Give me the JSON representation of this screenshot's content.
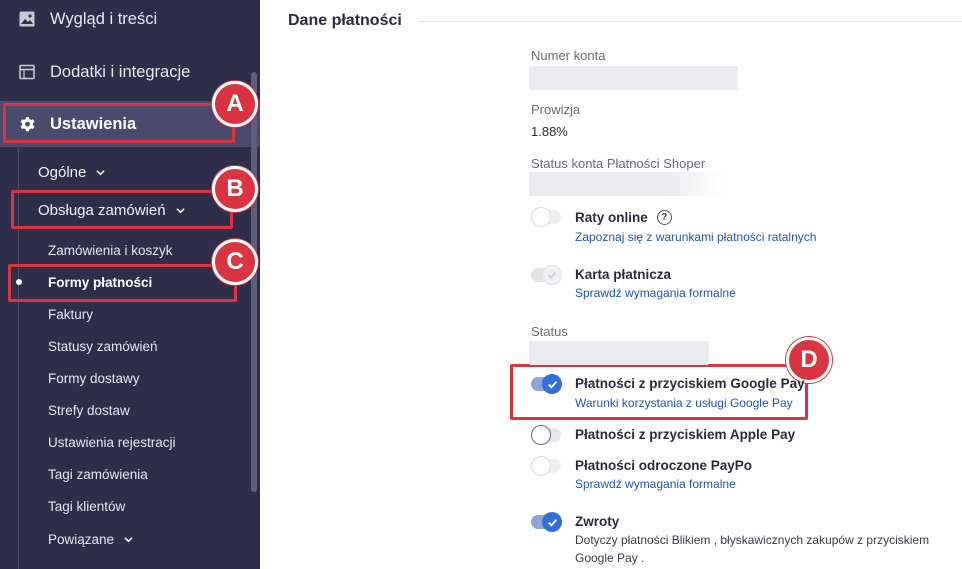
{
  "sidebar": {
    "main_items": [
      {
        "label": "Wygląd i treści",
        "icon": "image-icon"
      },
      {
        "label": "Dodatki i integracje",
        "icon": "calendar-icon"
      },
      {
        "label": "Ustawienia",
        "icon": "gear-icon"
      }
    ],
    "sub_items": [
      {
        "label": "Ogólne"
      },
      {
        "label": "Obsługa zamówień"
      }
    ],
    "order_items": [
      {
        "label": "Zamówienia i koszyk"
      },
      {
        "label": "Formy płatności"
      },
      {
        "label": "Faktury"
      },
      {
        "label": "Statusy zamówień"
      },
      {
        "label": "Formy dostawy"
      },
      {
        "label": "Strefy dostaw"
      },
      {
        "label": "Ustawienia rejestracji"
      },
      {
        "label": "Tagi zamówienia"
      },
      {
        "label": "Tagi klientów"
      },
      {
        "label": "Powiązane"
      }
    ]
  },
  "annotations": {
    "a": "A",
    "b": "B",
    "c": "C",
    "d": "D",
    "color": "#d9343f"
  },
  "main": {
    "section_title": "Dane płatności",
    "account_number_label": "Numer konta",
    "commission_label": "Prowizja",
    "commission_value": "1.88%",
    "account_status_label": "Status konta Płatności Shoper",
    "status_label": "Status",
    "options": [
      {
        "title": "Raty online",
        "link": "Zapoznaj się z warunkami płatności ratalnych",
        "state": "off-disabled"
      },
      {
        "title": "Karta płatnicza",
        "link": "Sprawdź wymagania formalne",
        "state": "on-disabled"
      },
      {
        "title": "Płatności z przyciskiem Google Pay",
        "link": "Warunki korzystania z usługi Google Pay",
        "state": "on"
      },
      {
        "title": "Płatności z przyciskiem Apple Pay",
        "state": "off"
      },
      {
        "title": "Płatności odroczone PayPo",
        "link": "Sprawdź wymagania formalne",
        "state": "off-disabled"
      },
      {
        "title": "Zwroty",
        "description": "Dotyczy płatności Blikiem , błyskawicznych zakupów z przyciskiem Google Pay .",
        "state": "on"
      }
    ]
  },
  "colors": {
    "sidebar_bg": "#2f2e4a",
    "sidebar_active": "#4b4a6e",
    "link": "#2455b3",
    "toggle_on": "#2f6fd6"
  }
}
